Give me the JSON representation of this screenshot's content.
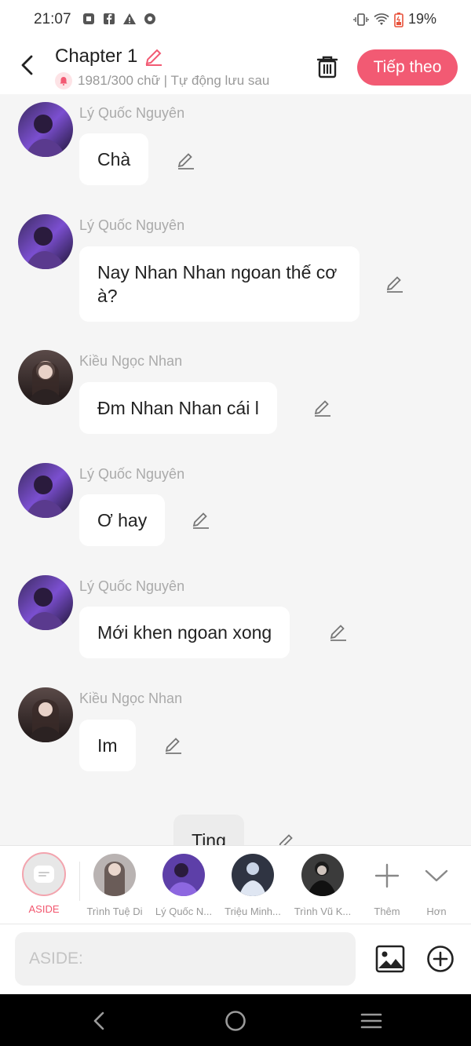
{
  "status": {
    "time": "21:07",
    "battery": "19%"
  },
  "header": {
    "title": "Chapter 1",
    "subtitle": "1981/300 chữ | Tự động lưu sau",
    "next_label": "Tiếp theo"
  },
  "messages": [
    {
      "name": "Lý Quốc Nguyên",
      "text": "Chà"
    },
    {
      "name": "Lý Quốc Nguyên",
      "text": "Nay Nhan Nhan ngoan thế cơ à?"
    },
    {
      "name": "Kiều Ngọc Nhan",
      "text": "Đm Nhan Nhan cái l"
    },
    {
      "name": "Lý Quốc Nguyên",
      "text": "Ơ hay"
    },
    {
      "name": "Lý Quốc Nguyên",
      "text": "Mới khen ngoan xong"
    },
    {
      "name": "Kiều Ngọc Nhan",
      "text": "Im"
    },
    {
      "name": "",
      "text": "Ting"
    }
  ],
  "characters": [
    {
      "label": "ASIDE"
    },
    {
      "label": "Trình Tuệ Di"
    },
    {
      "label": "Lý Quốc N..."
    },
    {
      "label": "Triệu Minh..."
    },
    {
      "label": "Trình Vũ K..."
    },
    {
      "label": "Thêm"
    },
    {
      "label": "Hơn"
    }
  ],
  "input": {
    "placeholder": "ASIDE:"
  },
  "colors": {
    "accent": "#f25a73",
    "background": "#f5f5f5"
  }
}
